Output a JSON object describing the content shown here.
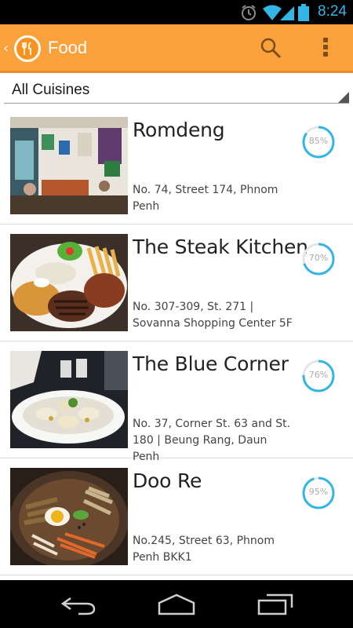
{
  "status_bar": {
    "time": "8:24",
    "icons": [
      "alarm-icon",
      "wifi-icon",
      "signal-icon",
      "battery-icon"
    ]
  },
  "action_bar": {
    "title": "Food",
    "app_icon": "fork-knife-logo-icon",
    "search_icon": "search-icon",
    "overflow_icon": "overflow-menu-icon"
  },
  "filter": {
    "selected": "All Cuisines"
  },
  "colors": {
    "action_bar": "#fba13b",
    "accent": "#33b5e5",
    "ring_track": "#e6e6e6"
  },
  "restaurants": [
    {
      "name": "Romdeng",
      "address": "No. 74, Street 174, Phnom Penh",
      "score": 0.85,
      "score_label": "85%"
    },
    {
      "name": "The Steak Kitchen",
      "address": "No. 307-309, St. 271 | Sovanna Shopping Center 5F",
      "score": 0.7,
      "score_label": "70%"
    },
    {
      "name": "The Blue Corner",
      "address": "No. 37, Corner St. 63 and St. 180 | Beung Rang, Daun Penh",
      "score": 0.76,
      "score_label": "76%"
    },
    {
      "name": "Doo Re",
      "address": "No.245, Street 63, Phnom Penh BKK1",
      "score": 0.95,
      "score_label": "95%"
    }
  ],
  "nav_bar": {
    "icons": [
      "back-icon",
      "home-icon",
      "recent-apps-icon"
    ]
  }
}
